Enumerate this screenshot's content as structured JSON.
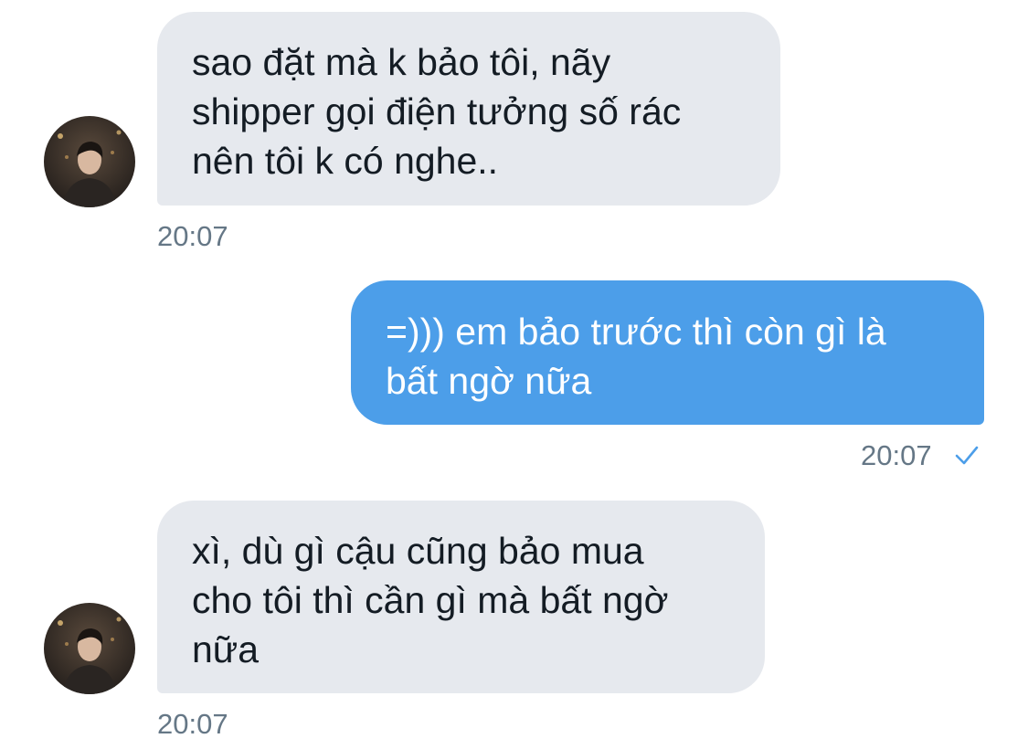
{
  "conversation": {
    "messages": [
      {
        "sender": "other",
        "lines": [
          "sao đặt mà k bảo tôi, nãy",
          "shipper gọi điện tưởng số rác",
          "nên tôi k có nghe.."
        ],
        "time": "20:07"
      },
      {
        "sender": "me",
        "lines": [
          "=))) em bảo trước thì còn gì là",
          "bất ngờ nữa"
        ],
        "time": "20:07",
        "status_icon": "checkmark-icon"
      },
      {
        "sender": "other",
        "lines": [
          "xì, dù gì cậu cũng bảo mua",
          "cho tôi thì cần gì mà bất ngờ",
          "nữa"
        ],
        "time": "20:07"
      }
    ]
  },
  "colors": {
    "incoming_bubble": "#e6e9ee",
    "outgoing_bubble": "#4c9ee9",
    "timestamp": "#657786",
    "read_check": "#4c9ee9"
  }
}
